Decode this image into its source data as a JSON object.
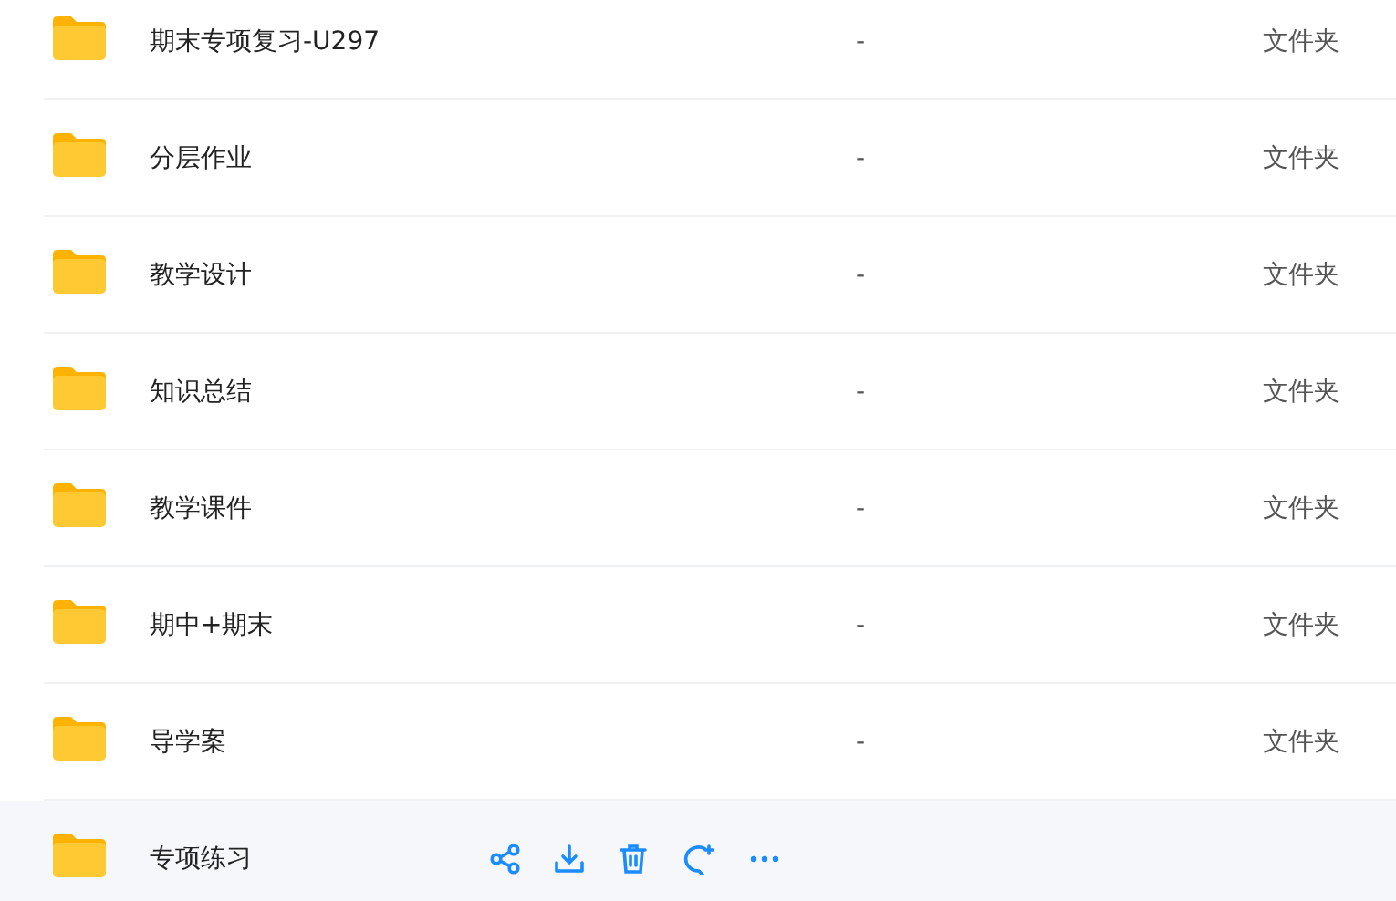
{
  "files": [
    {
      "name": "期末专项复习-U297",
      "size": "-",
      "type": "文件夹",
      "hovered": false
    },
    {
      "name": "分层作业",
      "size": "-",
      "type": "文件夹",
      "hovered": false
    },
    {
      "name": "教学设计",
      "size": "-",
      "type": "文件夹",
      "hovered": false
    },
    {
      "name": "知识总结",
      "size": "-",
      "type": "文件夹",
      "hovered": false
    },
    {
      "name": "教学课件",
      "size": "-",
      "type": "文件夹",
      "hovered": false
    },
    {
      "name": "期中+期末",
      "size": "-",
      "type": "文件夹",
      "hovered": false
    },
    {
      "name": "导学案",
      "size": "-",
      "type": "文件夹",
      "hovered": false
    },
    {
      "name": "专项练习",
      "hovered": true
    }
  ]
}
